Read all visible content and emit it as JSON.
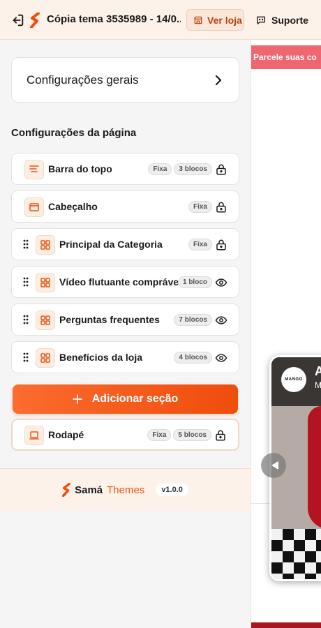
{
  "header": {
    "title": "Cópia tema 3535989 - 14/0...",
    "view_store_label": "Ver loja",
    "support_label": "Suporte"
  },
  "sidebar": {
    "general_settings_label": "Configurações gerais",
    "page_settings_heading": "Configurações da página",
    "sections": [
      {
        "label": "Barra do topo",
        "icon": "top-bar-icon",
        "badges": [
          "Fixa",
          "3 blocos"
        ],
        "state": "lock-icon",
        "draggable": false
      },
      {
        "label": "Cabeçalho",
        "icon": "header-window-icon",
        "badges": [
          "Fixa"
        ],
        "state": "lock-icon",
        "draggable": false
      },
      {
        "label": "Principal da Categoria",
        "icon": "grid-icon",
        "badges": [
          "Fixa"
        ],
        "state": "lock-icon",
        "draggable": true
      },
      {
        "label": "Vídeo flutuante comprável",
        "icon": "grid-icon",
        "badges": [
          "1 bloco"
        ],
        "state": "eye-icon",
        "draggable": true
      },
      {
        "label": "Perguntas frequentes",
        "icon": "grid-icon",
        "badges": [
          "7 blocos"
        ],
        "state": "eye-icon",
        "draggable": true
      },
      {
        "label": "Benefícios da loja",
        "icon": "grid-icon",
        "badges": [
          "4 blocos"
        ],
        "state": "eye-icon",
        "draggable": true
      }
    ],
    "add_section_label": "Adicionar seção",
    "footer_section": {
      "label": "Rodapé",
      "icon": "laptop-icon",
      "badges": [
        "Fixa",
        "5 blocos"
      ],
      "state": "lock-icon"
    }
  },
  "branding": {
    "name": "Samá",
    "suffix": "Themes",
    "version": "v1.0.0"
  },
  "preview": {
    "promo_text": "Parcele suas co",
    "video": {
      "logo_text": "MANGO",
      "title_fragment": "A",
      "subtitle_fragment": "M"
    }
  },
  "colors": {
    "accent": "#ef4d0c",
    "accent_light": "#fdeee3",
    "header_bg": "#fdf2ea",
    "promo_bg": "#ee6670"
  }
}
